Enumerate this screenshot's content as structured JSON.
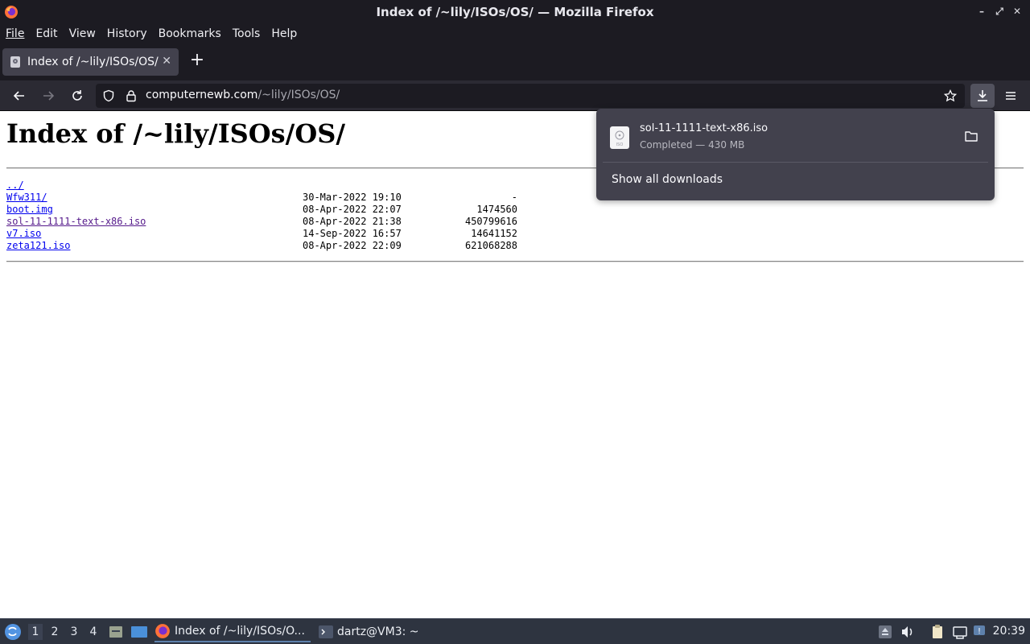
{
  "window": {
    "title": "Index of /~lily/ISOs/OS/ — Mozilla Firefox"
  },
  "menubar": {
    "items": [
      {
        "label": "File"
      },
      {
        "label": "Edit"
      },
      {
        "label": "View"
      },
      {
        "label": "History"
      },
      {
        "label": "Bookmarks"
      },
      {
        "label": "Tools"
      },
      {
        "label": "Help"
      }
    ]
  },
  "tabs": [
    {
      "label": "Index of /~lily/ISOs/OS/",
      "active": true
    }
  ],
  "urlbar": {
    "domain": "computernewb.com",
    "path": "/~lily/ISOs/OS/"
  },
  "page": {
    "heading": "Index of /~lily/ISOs/OS/",
    "parent_link": "../",
    "entries": [
      {
        "name": "Wfw311/",
        "date": "30-Mar-2022 19:10",
        "size": "-"
      },
      {
        "name": "boot.img",
        "date": "08-Apr-2022 22:07",
        "size": "1474560"
      },
      {
        "name": "sol-11-1111-text-x86.iso",
        "date": "08-Apr-2022 21:38",
        "size": "450799616"
      },
      {
        "name": "v7.iso",
        "date": "14-Sep-2022 16:57",
        "size": "14641152"
      },
      {
        "name": "zeta121.iso",
        "date": "08-Apr-2022 22:09",
        "size": "621068288"
      }
    ]
  },
  "downloads_panel": {
    "file_name": "sol-11-1111-text-x86.iso",
    "status": "Completed — 430 MB",
    "show_all_label": "Show all downloads"
  },
  "taskbar": {
    "workspaces": [
      "1",
      "2",
      "3",
      "4"
    ],
    "active_workspace": "1",
    "apps": [
      {
        "label": "Index of /~lily/ISOs/O...",
        "icon": "firefox-icon",
        "active": true
      },
      {
        "label": "dartz@VM3: ~",
        "icon": "terminal-icon",
        "active": false
      }
    ],
    "clock": "20:39"
  },
  "colors": {
    "chrome_dark": "#1c1b22",
    "toolbar": "#2b2a33",
    "panel": "#42414d",
    "link": "#0000ee",
    "visited_link": "#551a8b",
    "taskbar": "#2e3440"
  }
}
